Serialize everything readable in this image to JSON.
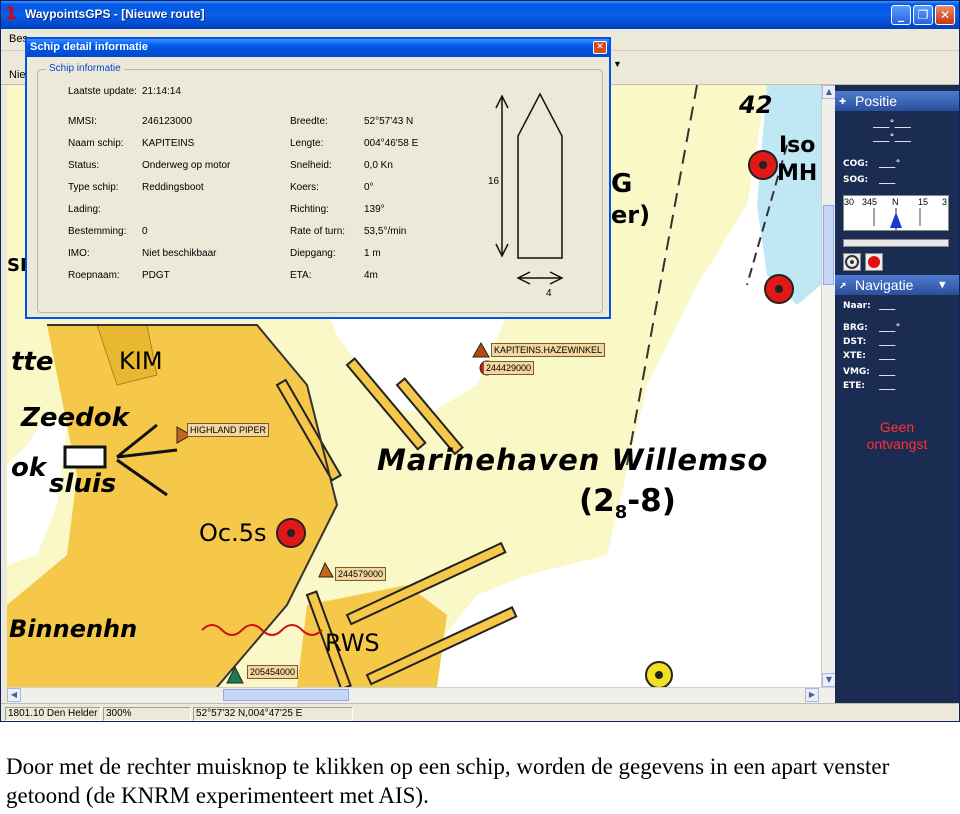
{
  "window": {
    "icon": "1",
    "title": "WaypointsGPS - [Nieuwe route]",
    "buttons": {
      "minimize": "_",
      "maximize": "❐",
      "close": "✕"
    }
  },
  "menubar": {
    "partial_label": "Bes"
  },
  "toolbar": {
    "partial_label": "Nie"
  },
  "popup": {
    "title": "Schip detail informatie",
    "close_label": "✕",
    "group_title": "Schip informatie",
    "last_update_label": "Laatste update:",
    "last_update_value": "21:14:14",
    "left_fields": [
      {
        "label": "MMSI:",
        "value": "246123000"
      },
      {
        "label": "Naam schip:",
        "value": "KAPITEINS"
      },
      {
        "label": "Status:",
        "value": "Onderweg op motor"
      },
      {
        "label": "Type schip:",
        "value": "Reddingsboot"
      },
      {
        "label": "Lading:",
        "value": ""
      },
      {
        "label": "Bestemming:",
        "value": "0"
      },
      {
        "label": "IMO:",
        "value": "Niet beschikbaar"
      },
      {
        "label": "Roepnaam:",
        "value": "PDGT"
      }
    ],
    "right_fields": [
      {
        "label": "Breedte:",
        "value": "52°57'43 N"
      },
      {
        "label": "Lengte:",
        "value": "004°46'58 E"
      },
      {
        "label": "Snelheid:",
        "value": "0,0 Kn"
      },
      {
        "label": "Koers:",
        "value": "0°"
      },
      {
        "label": "Richting:",
        "value": "139°"
      },
      {
        "label": "Rate of turn:",
        "value": "53,5°/min"
      },
      {
        "label": "Diepgang:",
        "value": "1 m"
      },
      {
        "label": "ETA:",
        "value": "4m"
      }
    ],
    "ship_length": "16",
    "ship_width": "4"
  },
  "map": {
    "labels": {
      "marinehaven": "Marinehaven Willemso",
      "depth": "(2",
      "depth_sub": "8",
      "depth_end": "-8)",
      "kim": "KIM",
      "zeedok": "Zeedok",
      "sluis": "sluis",
      "ok": "ok",
      "tte": "tte",
      "oc5s": "Oc.5s",
      "binnenhn": "Binnenhn",
      "rws": "RWS",
      "num_42": "42",
      "iso": "Iso",
      "mh": "MH",
      "gg": "G",
      "er": "er)",
      "sk": "SK"
    },
    "ships": [
      {
        "label": "KAPITEINS.HAZEWINKEL",
        "color": "#b84a10"
      },
      {
        "label": "244429000",
        "color": "#b84a10"
      },
      {
        "label": "HIGHLAND PIPER",
        "color": "#c86418"
      },
      {
        "label": "244579000",
        "color": "#c86418"
      },
      {
        "label": "205454000",
        "color": "#1a7a50"
      }
    ]
  },
  "status": {
    "cell1": "1801.10 Den Helder",
    "cell2": "300%",
    "cell3": "52°57'32 N,004°47'25 E"
  },
  "sidepanel": {
    "positie_title": "Positie",
    "pos_line1": "___°___",
    "pos_line2": "___°___",
    "cog_label": "COG:",
    "cog_value": "___°",
    "sog_label": "SOG:",
    "sog_value": "___",
    "compass_ticks": [
      "30",
      "345",
      "N",
      "15",
      "3"
    ],
    "navigatie_title": "Navigatie",
    "naar_label": "Naar:",
    "naar_value": "___",
    "nav_rows": [
      {
        "label": "BRG:",
        "value": "___°"
      },
      {
        "label": "DST:",
        "value": "___"
      },
      {
        "label": "XTE:",
        "value": "___"
      },
      {
        "label": "VMG:",
        "value": "___"
      },
      {
        "label": "ETE:",
        "value": "___"
      }
    ],
    "geen_line1": "Geen",
    "geen_line2": "ontvangst",
    "colors": {
      "panel": "#1a2c52",
      "warning": "#ff3030"
    }
  },
  "caption": "Door met de rechter muisknop te klikken op een schip, worden de gegevens in een apart venster getoond (de KNRM experimenteert met AIS)."
}
